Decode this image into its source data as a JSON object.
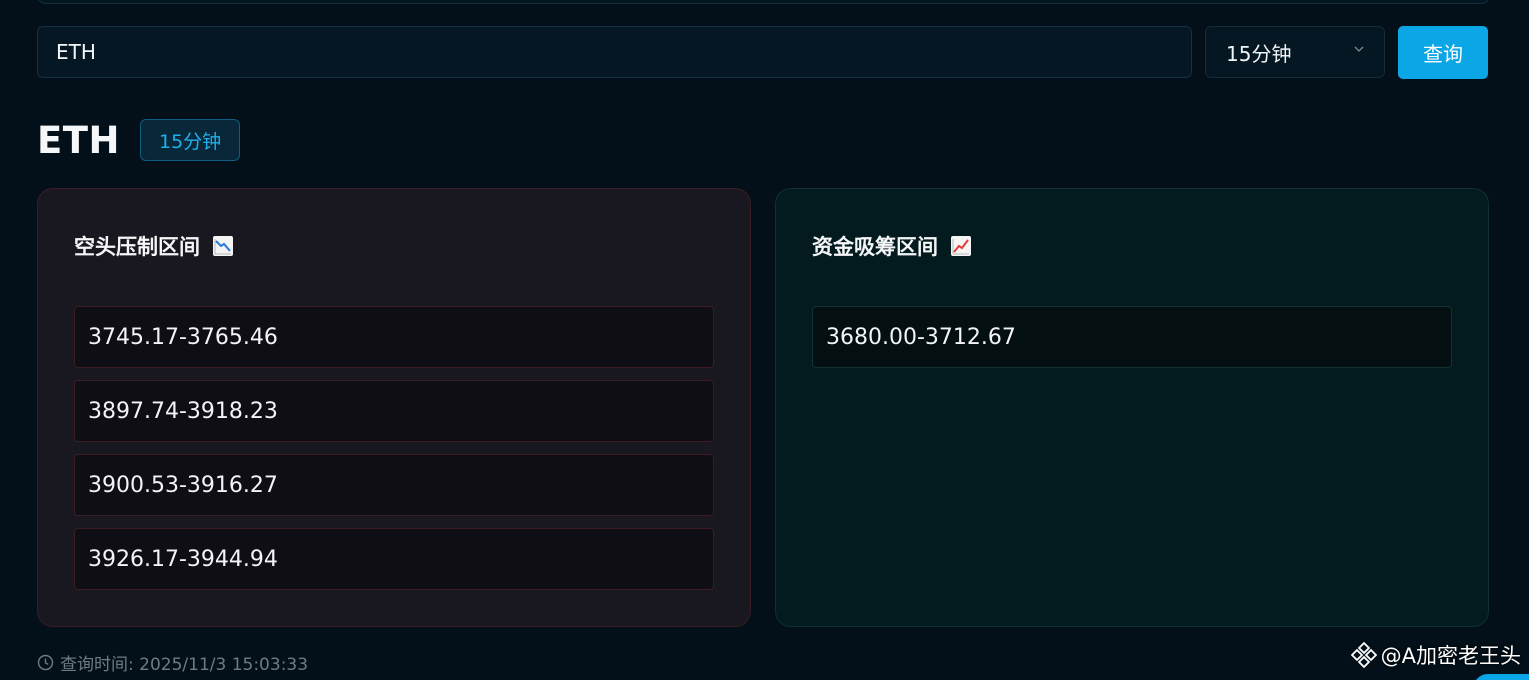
{
  "search": {
    "symbol_value": "ETH",
    "interval_selected": "15分钟",
    "query_label": "查询"
  },
  "heading": {
    "symbol": "ETH",
    "interval_badge": "15分钟"
  },
  "panels": {
    "short": {
      "title": "空头压制区间",
      "icon": "chart-decreasing-icon",
      "ranges": [
        "3745.17-3765.46",
        "3897.74-3918.23",
        "3900.53-3916.27",
        "3926.17-3944.94"
      ]
    },
    "accumulation": {
      "title": "资金吸筹区间",
      "icon": "chart-increasing-icon",
      "ranges": [
        "3680.00-3712.67"
      ]
    }
  },
  "footer": {
    "query_time": "查询时间: 2025/11/3 15:03:33"
  },
  "watermark": {
    "text": "@A加密老王头"
  },
  "colors": {
    "accent": "#0aa6e6",
    "background": "#031019",
    "short_panel": "#19171f",
    "accum_panel": "#031a1e"
  }
}
